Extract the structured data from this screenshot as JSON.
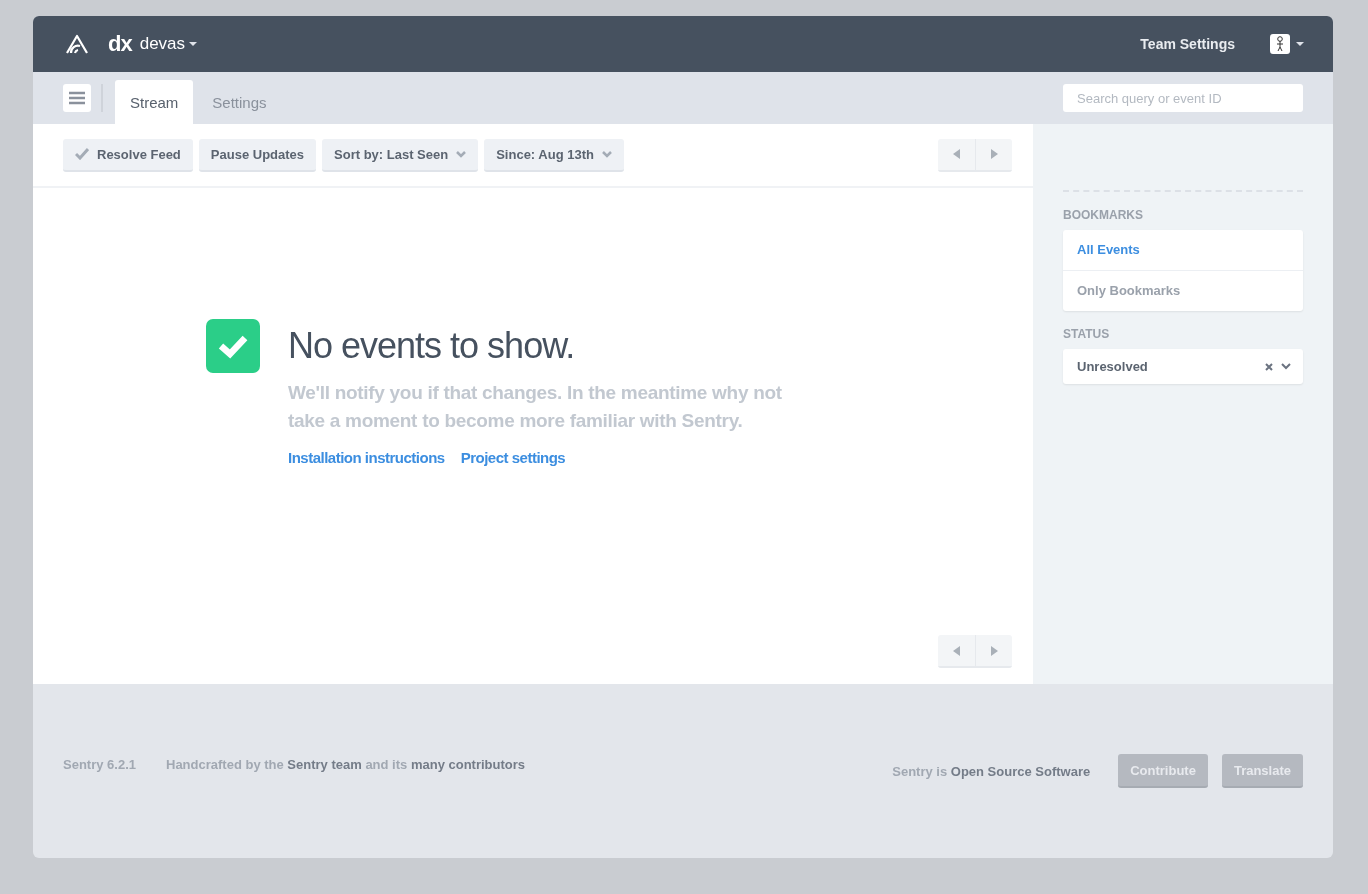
{
  "header": {
    "org_short": "dx",
    "org_name": "devas",
    "team_settings": "Team Settings"
  },
  "subnav": {
    "tabs": [
      {
        "label": "Stream",
        "selected": true
      },
      {
        "label": "Settings",
        "selected": false
      }
    ],
    "search": {
      "placeholder": "Search query or event ID"
    }
  },
  "toolbar": {
    "buttons": [
      {
        "label": "Resolve Feed",
        "kind": "check"
      },
      {
        "label": "Pause Updates",
        "kind": "plain"
      },
      {
        "label": "Sort by: Last Seen",
        "kind": "dropdown"
      },
      {
        "label": "Since: Aug 13th",
        "kind": "dropdown"
      }
    ]
  },
  "empty_state": {
    "title": "No events to show.",
    "message": "We'll notify you if that changes. In the meantime why not take a moment to become more familiar with Sentry.",
    "links": [
      "Installation instructions",
      "Project settings"
    ]
  },
  "sidebar": {
    "bookmarks_heading": "BOOKMARKS",
    "bookmarks": [
      {
        "label": "All Events",
        "selected": true
      },
      {
        "label": "Only Bookmarks",
        "selected": false
      }
    ],
    "status_heading": "STATUS",
    "status_value": "Unresolved"
  },
  "footer": {
    "version": "Sentry 6.2.1",
    "credits": "Handcrafted by the **Sentry team** and its **many contributors**",
    "open_source": "Sentry is **Open Source Software**",
    "buttons": [
      "Contribute",
      "Translate"
    ]
  }
}
